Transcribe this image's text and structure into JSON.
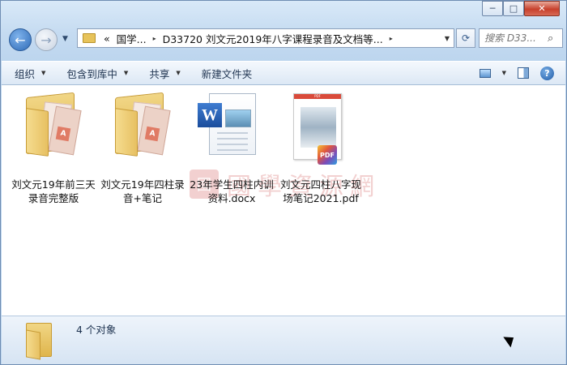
{
  "window": {
    "minimize_glyph": "─",
    "maximize_glyph": "□",
    "close_glyph": "✕"
  },
  "nav": {
    "back_glyph": "←",
    "forward_glyph": "→",
    "recent_dropdown": "▼",
    "address": {
      "overflow": "«",
      "crumbs": [
        "国学...",
        "D33720 刘文元2019年八字课程录音及文档等..."
      ],
      "separator": "▸",
      "dropdown": "▼"
    },
    "refresh_glyph": "⟳",
    "search": {
      "placeholder": "搜索 D33...",
      "icon": "search-icon"
    }
  },
  "toolbar": {
    "organize": "组织",
    "include_in_library": "包含到库中",
    "share": "共享",
    "new_folder": "新建文件夹",
    "help_glyph": "?"
  },
  "files": [
    {
      "name": "刘文元19年前三天录音完整版",
      "type": "folder"
    },
    {
      "name": "刘文元19年四柱录音+笔记",
      "type": "folder"
    },
    {
      "name": "23年学生四柱内训资料.docx",
      "type": "docx"
    },
    {
      "name": "刘文元四柱八字现场笔记2021.pdf",
      "type": "pdf"
    }
  ],
  "icon_text": {
    "folder_badge": "A",
    "word_badge": "W",
    "pdf_bar": "PDF",
    "pdf_badge": "PDF"
  },
  "watermark": {
    "seal": "國",
    "text": "國學資源網"
  },
  "details": {
    "count_text": "4 个对象"
  },
  "colors": {
    "accent": "#2f6bb7",
    "close_button": "#c7402c",
    "folder": "#e7c062"
  }
}
